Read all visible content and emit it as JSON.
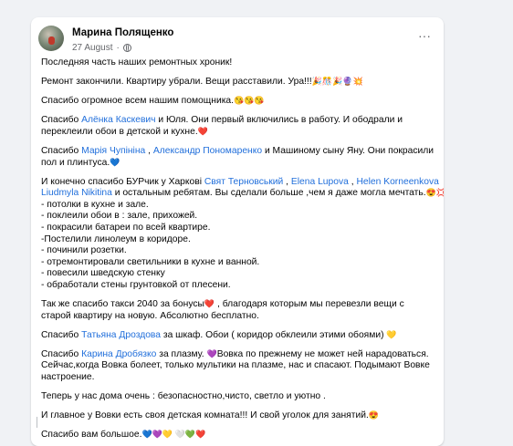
{
  "post": {
    "author": "Марина Полященко",
    "date": "27 August",
    "privacy_icon": "globe-icon",
    "more_label": "···"
  },
  "paragraphs": [
    {
      "lines": [
        [
          {
            "t": "Последняя часть наших ремонтных хроник!"
          }
        ]
      ]
    },
    {
      "lines": [
        [
          {
            "t": "Ремонт закончили. Квартиру убрали. Вещи расставили. Ура!!!"
          },
          {
            "e": "🎉🎊🎉🔮💥"
          }
        ]
      ]
    },
    {
      "lines": [
        [
          {
            "t": "Спасибо огромное всем нашим помощника."
          },
          {
            "e": "😘😘😘"
          }
        ]
      ]
    },
    {
      "lines": [
        [
          {
            "t": "Спасибо "
          },
          {
            "m": "Алёнка Каскевич"
          },
          {
            "t": " и Юля. Они первый включились в работу. И ободрали и"
          }
        ],
        [
          {
            "t": "переклеили обои в детской и кухне."
          },
          {
            "e": "❤️"
          }
        ]
      ]
    },
    {
      "lines": [
        [
          {
            "t": "Спасибо "
          },
          {
            "m": "Марія Чупініна"
          },
          {
            "t": " , "
          },
          {
            "m": "Александр Пономаренко"
          },
          {
            "t": " и Машиному сыну Яну. Они покрасили"
          }
        ],
        [
          {
            "t": "пол и плинтуса."
          },
          {
            "e": "💙"
          }
        ]
      ]
    },
    {
      "lines": [
        [
          {
            "t": " И конечно спасибо БУРчик у Харкові "
          },
          {
            "m": "Свят Терновський"
          },
          {
            "t": " , "
          },
          {
            "m": "Elena Lupova"
          },
          {
            "t": " , "
          },
          {
            "m": "Helen Korneenkova"
          }
        ],
        [
          {
            "m": "Liudmyla Nikitina"
          },
          {
            "t": "  и остальным ребятам. Вы сделали больше ,чем я даже могла мечтать."
          },
          {
            "e": "😍💢"
          }
        ],
        [
          {
            "t": "- потолки в кухне и зале."
          }
        ],
        [
          {
            "t": "- поклеили обои в : зале, прихожей."
          }
        ],
        [
          {
            "t": "- покрасили батареи по всей квартире."
          }
        ],
        [
          {
            "t": "-Постелили линолеум в коридоре."
          }
        ],
        [
          {
            "t": "- починили розетки."
          }
        ],
        [
          {
            "t": "- отремонтировали светильники в кухне и ванной."
          }
        ],
        [
          {
            "t": "- повесили шведскую стенку"
          }
        ],
        [
          {
            "t": "- обработали стены грунтовкой от плесени."
          }
        ]
      ]
    },
    {
      "lines": [
        [
          {
            "t": " Так же спасибо такси 2040 за бонусы"
          },
          {
            "e": "❤️"
          },
          {
            "t": " , благодаря которым мы перевезли вещи с"
          }
        ],
        [
          {
            "t": "старой квартиру на новую. Абсолютно бесплатно."
          }
        ]
      ]
    },
    {
      "lines": [
        [
          {
            "t": "Спасибо "
          },
          {
            "m": "Татьяна Дроздова"
          },
          {
            "t": " за шкаф. Обои ( коридор обклеили этими обоями) "
          },
          {
            "e": "💛"
          }
        ]
      ]
    },
    {
      "lines": [
        [
          {
            "t": "Спасибо "
          },
          {
            "m": "Карина Дробязко"
          },
          {
            "t": " за плазму. "
          },
          {
            "e": "💜"
          },
          {
            "t": "Вовка по прежнему не может ней нарадоваться."
          }
        ],
        [
          {
            "t": "Сейчас,когда Вовка болеет, только мультики на  плазме, нас и спасают. Подымают  Вовке"
          }
        ],
        [
          {
            "t": "настроение."
          }
        ]
      ]
    },
    {
      "lines": [
        [
          {
            "t": "  Теперь у нас дома очень : безопасностно,чисто, светло и уютно ."
          }
        ]
      ]
    },
    {
      "lines": [
        [
          {
            "t": "И главное у Вовки есть своя детская комната!!! И свой уголок для занятий."
          },
          {
            "e": "😍"
          }
        ]
      ]
    },
    {
      "lines": [
        [
          {
            "t": " Спасибо вам большое."
          },
          {
            "e": "💙💜💛 🤍💚❤️"
          }
        ]
      ]
    }
  ]
}
